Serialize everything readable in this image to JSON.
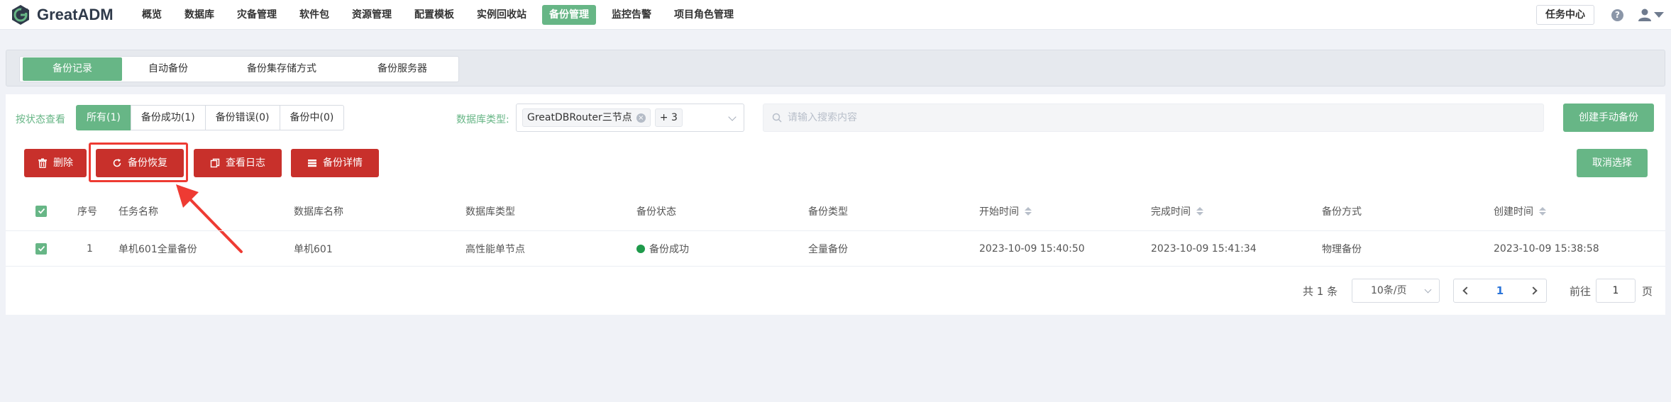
{
  "app": {
    "name": "GreatADM",
    "logo_icon": "greatadm-logo-icon"
  },
  "nav": {
    "items": [
      "概览",
      "数据库",
      "灾备管理",
      "软件包",
      "资源管理",
      "配置模板",
      "实例回收站",
      "备份管理",
      "监控告警",
      "项目角色管理"
    ],
    "active": "备份管理",
    "task_center": "任务中心",
    "help_icon": "help-circle-icon",
    "user_icon": "user-icon",
    "accent_color": "#67b686"
  },
  "tabs": {
    "items": [
      "备份记录",
      "自动备份",
      "备份集存储方式",
      "备份服务器"
    ],
    "active": "备份记录"
  },
  "filters": {
    "status_label": "按状态查看",
    "status_options": [
      "所有(1)",
      "备份成功(1)",
      "备份错误(0)",
      "备份中(0)"
    ],
    "status_active": "所有(1)",
    "db_type_label": "数据库类型:",
    "db_type_selected": "GreatDBRouter三节点",
    "db_type_more": "+ 3",
    "search_placeholder": "请输入搜索内容",
    "search_value": ""
  },
  "actions": {
    "create_manual": "创建手动备份",
    "delete": "删除",
    "restore": "备份恢复",
    "view_log": "查看日志",
    "detail": "备份详情",
    "cancel_select": "取消选择",
    "danger_color": "#c8302b",
    "highlight_color": "#ee3b33"
  },
  "table": {
    "headers": {
      "index": "序号",
      "task_name": "任务名称",
      "db_name": "数据库名称",
      "db_type": "数据库类型",
      "status": "备份状态",
      "backup_type": "备份类型",
      "start_time": "开始时间",
      "end_time": "完成时间",
      "method": "备份方式",
      "created_time": "创建时间"
    },
    "rows": [
      {
        "index": "1",
        "task_name": "单机601全量备份",
        "db_name": "单机601",
        "db_type": "高性能单节点",
        "status": "备份成功",
        "status_color": "#1f9a4b",
        "backup_type": "全量备份",
        "start_time": "2023-10-09 15:40:50",
        "end_time": "2023-10-09 15:41:34",
        "method": "物理备份",
        "created_time": "2023-10-09 15:38:58"
      }
    ]
  },
  "pagination": {
    "total": "共 1 条",
    "page_size": "10条/页",
    "current_page": "1",
    "goto_label": "前往",
    "goto_value": "1",
    "page_unit": "页"
  }
}
